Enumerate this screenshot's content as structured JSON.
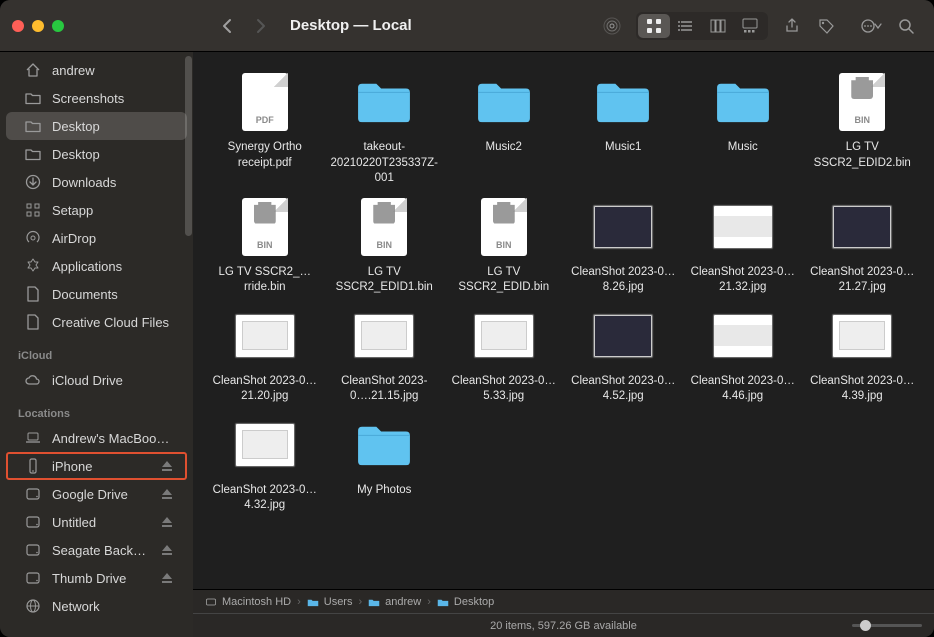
{
  "window_title": "Desktop — Local",
  "sidebar": {
    "sections": [
      {
        "label": "",
        "items": [
          {
            "icon": "home",
            "label": "andrew"
          },
          {
            "icon": "folder",
            "label": "Screenshots"
          },
          {
            "icon": "folder",
            "label": "Desktop",
            "selected": true
          },
          {
            "icon": "folder",
            "label": "Desktop"
          },
          {
            "icon": "download",
            "label": "Downloads"
          },
          {
            "icon": "grid",
            "label": "Setapp"
          },
          {
            "icon": "airdrop",
            "label": "AirDrop"
          },
          {
            "icon": "apps",
            "label": "Applications"
          },
          {
            "icon": "doc",
            "label": "Documents"
          },
          {
            "icon": "doc",
            "label": "Creative Cloud Files"
          }
        ]
      },
      {
        "label": "iCloud",
        "items": [
          {
            "icon": "cloud",
            "label": "iCloud Drive"
          }
        ]
      },
      {
        "label": "Locations",
        "items": [
          {
            "icon": "laptop",
            "label": "Andrew's MacBoo…"
          },
          {
            "icon": "phone",
            "label": "iPhone",
            "eject": true,
            "highlighted": true
          },
          {
            "icon": "disk",
            "label": "Google Drive",
            "eject": true
          },
          {
            "icon": "disk",
            "label": "Untitled",
            "eject": true
          },
          {
            "icon": "disk",
            "label": "Seagate Backu…",
            "eject": true
          },
          {
            "icon": "disk",
            "label": "Thumb Drive",
            "eject": true
          },
          {
            "icon": "globe",
            "label": "Network"
          }
        ]
      }
    ]
  },
  "items": [
    {
      "kind": "pdf",
      "label": "Synergy Ortho receipt.pdf",
      "badge": "PDF"
    },
    {
      "kind": "folder",
      "label": "takeout-20210220T235337Z-001"
    },
    {
      "kind": "folder",
      "label": "Music2"
    },
    {
      "kind": "folder",
      "label": "Music1"
    },
    {
      "kind": "folder",
      "label": "Music"
    },
    {
      "kind": "bin",
      "label": "LG TV SSCR2_EDID2.bin",
      "badge": "BIN"
    },
    {
      "kind": "bin",
      "label": "LG TV SSCR2_…rride.bin",
      "badge": "BIN"
    },
    {
      "kind": "bin",
      "label": "LG TV SSCR2_EDID1.bin",
      "badge": "BIN"
    },
    {
      "kind": "bin",
      "label": "LG TV SSCR2_EDID.bin",
      "badge": "BIN"
    },
    {
      "kind": "shot-dark",
      "label": "CleanShot 2023-0…8.26.jpg"
    },
    {
      "kind": "shot-wide",
      "label": "CleanShot 2023-0…21.32.jpg"
    },
    {
      "kind": "shot-dark",
      "label": "CleanShot 2023-0…21.27.jpg"
    },
    {
      "kind": "shot",
      "label": "CleanShot 2023-0…21.20.jpg"
    },
    {
      "kind": "shot",
      "label": "CleanShot 2023-0….21.15.jpg"
    },
    {
      "kind": "shot",
      "label": "CleanShot 2023-0…5.33.jpg"
    },
    {
      "kind": "shot-dark",
      "label": "CleanShot 2023-0…4.52.jpg"
    },
    {
      "kind": "shot-wide",
      "label": "CleanShot 2023-0…4.46.jpg"
    },
    {
      "kind": "shot",
      "label": "CleanShot 2023-0…4.39.jpg"
    },
    {
      "kind": "shot",
      "label": "CleanShot 2023-0…4.32.jpg"
    },
    {
      "kind": "folder",
      "label": "My Photos"
    }
  ],
  "pathbar": [
    {
      "icon": "disk",
      "label": "Macintosh HD"
    },
    {
      "icon": "folder-blue",
      "label": "Users"
    },
    {
      "icon": "folder-blue",
      "label": "andrew"
    },
    {
      "icon": "folder-blue",
      "label": "Desktop"
    }
  ],
  "status": "20 items, 597.26 GB available"
}
